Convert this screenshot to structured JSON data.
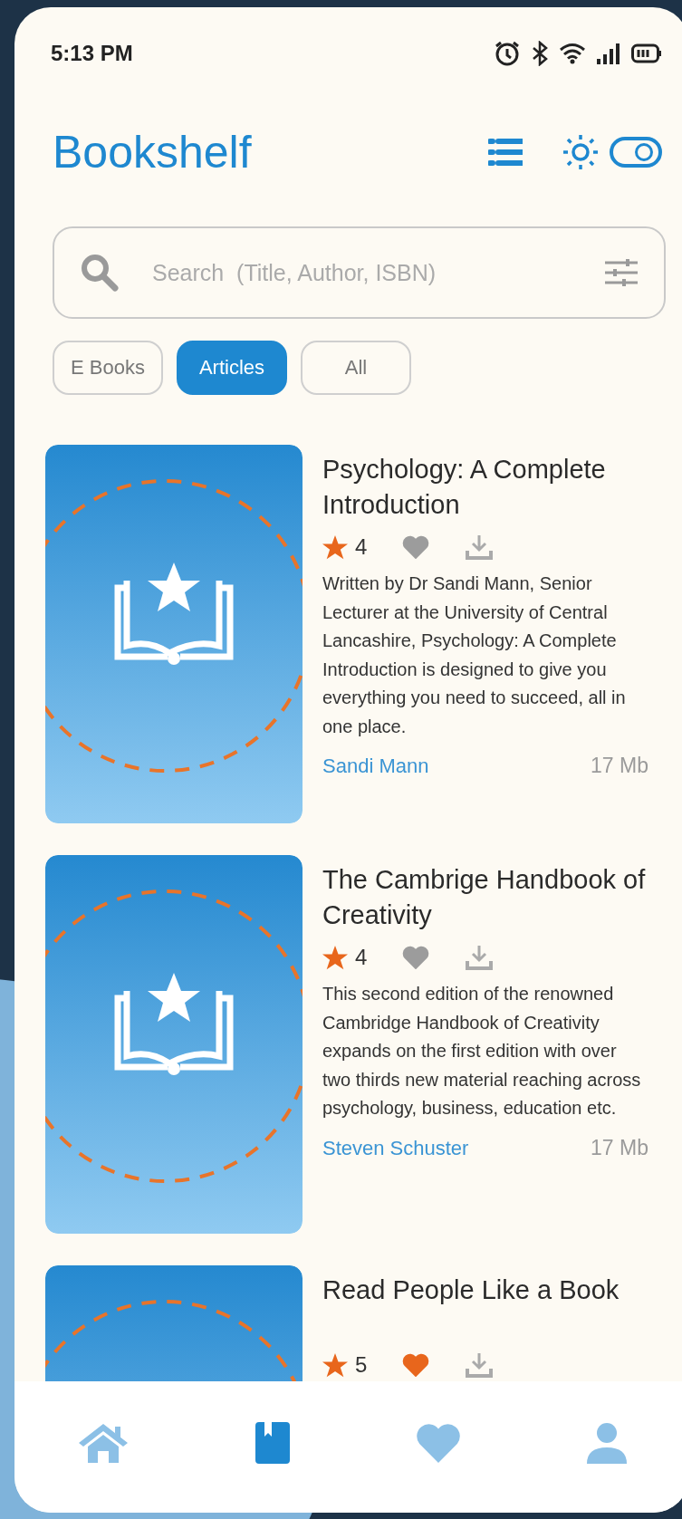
{
  "status_bar": {
    "time": "5:13 PM"
  },
  "header": {
    "title": "Bookshelf",
    "theme_switch": {
      "on": true
    }
  },
  "search": {
    "placeholder": "Search  (Title, Author, ISBN)"
  },
  "filters": [
    {
      "label": "E Books",
      "selected": false
    },
    {
      "label": "Articles",
      "selected": true
    },
    {
      "label": "All",
      "selected": false
    }
  ],
  "books": [
    {
      "title": "Psychology: A Complete Introduction",
      "rating": "4",
      "liked": false,
      "description": "Written by Dr Sandi Mann, Senior Lecturer at the University of Central Lancashire, Psychology: A Complete Introduction is designed to give you everything you need to succeed, all in one place.",
      "author": "Sandi Mann",
      "size": "17 Mb"
    },
    {
      "title": "The Cambrige Handbook of Creativity",
      "rating": "4",
      "liked": false,
      "description": "This second edition of the renowned Cambridge Handbook of Creativity expands on the first edition with over two thirds new material reaching across psychology, business, education etc.",
      "author": "Steven Schuster",
      "size": "17 Mb"
    },
    {
      "title": "Read People Like a Book",
      "rating": "5",
      "liked": true
    }
  ],
  "nav": [
    {
      "kind": "home",
      "selected": false
    },
    {
      "kind": "library",
      "selected": true
    },
    {
      "kind": "favorites",
      "selected": false
    },
    {
      "kind": "profile",
      "selected": false
    }
  ]
}
